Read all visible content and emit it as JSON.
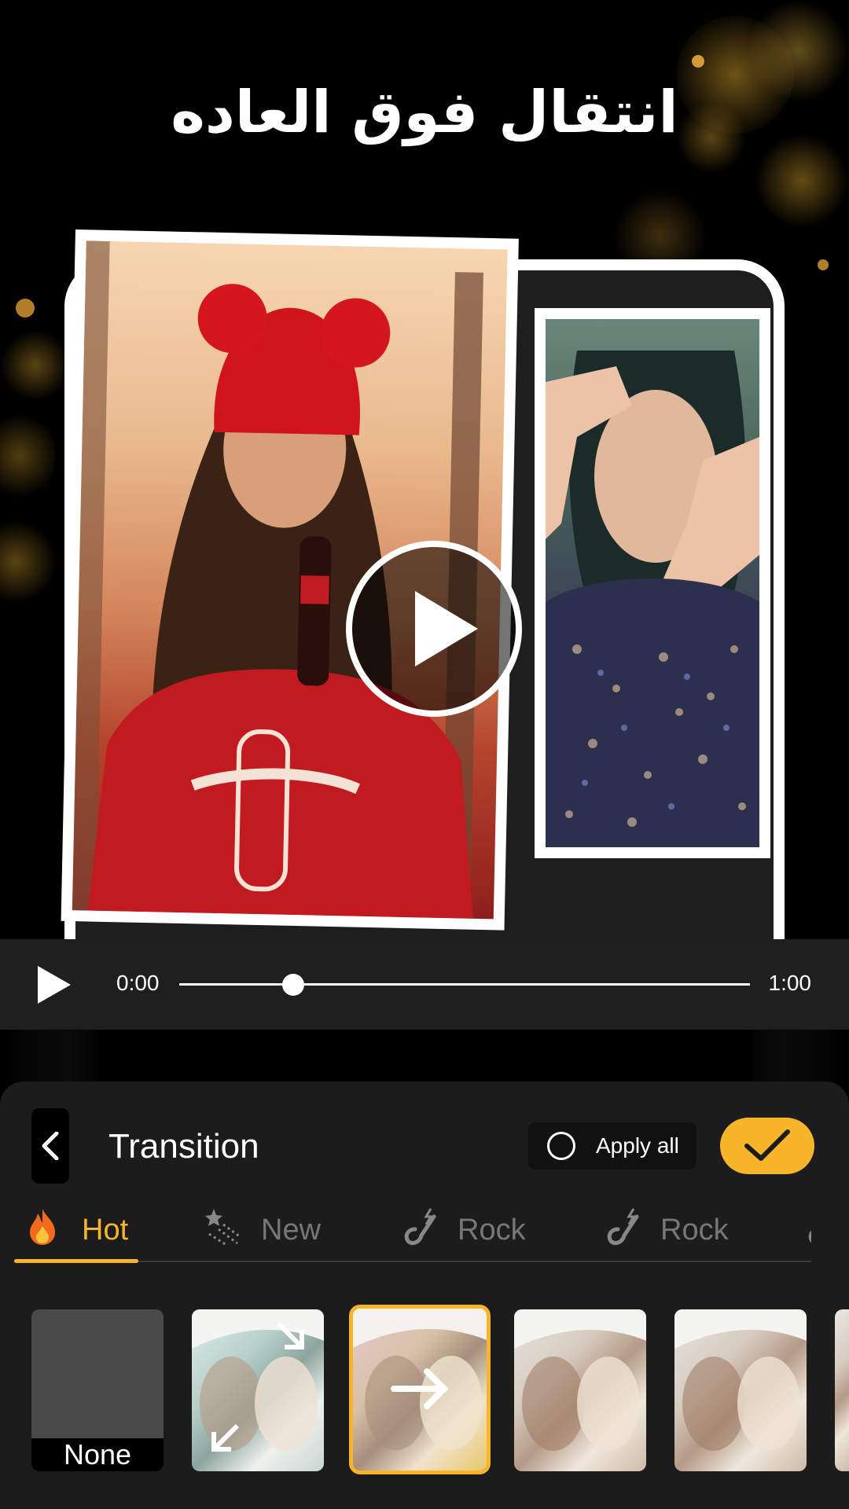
{
  "promo": {
    "headline": "انتقال فوق العاده"
  },
  "player": {
    "current_time": "0:00",
    "duration": "1:00",
    "progress": 0.2
  },
  "editor": {
    "title": "Transition",
    "apply_all_label": "Apply all",
    "tabs": [
      {
        "label": "Hot",
        "icon": "fire-icon",
        "active": true
      },
      {
        "label": "New",
        "icon": "sparkle-stars-icon",
        "active": false
      },
      {
        "label": "Rock",
        "icon": "electric-guitar-icon",
        "active": false
      },
      {
        "label": "Rock",
        "icon": "electric-guitar-icon",
        "active": false
      }
    ],
    "thumbnails": [
      {
        "label": "None",
        "selected": false
      },
      {
        "label": "",
        "selected": false
      },
      {
        "label": "",
        "selected": true
      },
      {
        "label": "",
        "selected": false
      },
      {
        "label": "",
        "selected": false
      }
    ]
  },
  "colors": {
    "accent": "#f8b52a",
    "panel_bg": "#1c1c1c",
    "player_bg": "#1f1f1f"
  }
}
